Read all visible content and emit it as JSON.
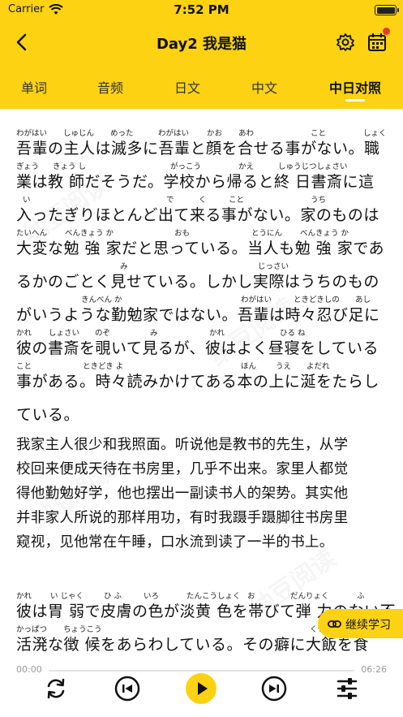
{
  "status_bar": {
    "carrier": "Carrier",
    "time": "7:52 PM"
  },
  "nav": {
    "title": "Day2 我是猫"
  },
  "tabs": [
    {
      "label": "单词"
    },
    {
      "label": "音频"
    },
    {
      "label": "日文"
    },
    {
      "label": "中文"
    },
    {
      "label": "中日对照",
      "active": true
    }
  ],
  "lines": [
    {
      "ruby": [
        [
          "わがはい",
          20
        ],
        [
          "しゅじん",
          78
        ],
        [
          "めった",
          136
        ],
        [
          "わがはい",
          195
        ],
        [
          "かお",
          255
        ],
        [
          "あわ",
          294
        ],
        [
          "こと",
          383
        ],
        [
          "しょく",
          448
        ]
      ],
      "text": "吾輩の主人は滅多に吾輩と顔を合せる事がない。職"
    },
    {
      "ruby": [
        [
          "ぎょう",
          20
        ],
        [
          "きょう し",
          65
        ],
        [
          "がっこう",
          210
        ],
        [
          "かえ",
          294
        ],
        [
          "しゅうじつしょさい",
          343
        ]
      ],
      "text": "業は教 師だそうだ。学校から帰ると終 日書斎に這"
    },
    {
      "ruby": [
        [
          "い",
          28
        ],
        [
          "で",
          205
        ],
        [
          "く",
          245
        ],
        [
          "こと",
          282
        ],
        [
          "うち",
          383
        ]
      ],
      "text": "入ったぎりほとんど出て来る事がない。家のものは"
    },
    {
      "ruby": [
        [
          "たいへん",
          20
        ],
        [
          "べんきょう か",
          80
        ],
        [
          "おも",
          215
        ],
        [
          "とうにん",
          310
        ],
        [
          "べんきょう か",
          370
        ]
      ],
      "text": "大変な勉 強 家だと思っている。当人も勉 強 家であ"
    },
    {
      "ruby": [
        [
          "み",
          148
        ],
        [
          "じっさい",
          318
        ]
      ],
      "text": "るかのごとく見せている。しかし実際はうちのもの"
    },
    {
      "ruby": [
        [
          "きんべん か",
          100
        ],
        [
          "わがはい",
          297
        ],
        [
          "ときどきしの",
          362
        ],
        [
          "あし",
          438
        ]
      ],
      "text": "がいうような勤勉家ではない。吾輩は時々忍び足に"
    },
    {
      "ruby": [
        [
          "かれ",
          20
        ],
        [
          "しょさい",
          60
        ],
        [
          "のぞ",
          117
        ],
        [
          "み",
          185
        ],
        [
          "かれ",
          258
        ],
        [
          "ひる ね",
          345
        ]
      ],
      "text": "彼の書斎を覗いて見るが、彼はよく昼寝をしている"
    },
    {
      "ruby": [
        [
          "こと",
          20
        ],
        [
          "ときどき よ",
          102
        ],
        [
          "ほん",
          297
        ],
        [
          "うえ",
          340
        ],
        [
          "よだれ",
          378
        ]
      ],
      "text": "事がある。時々読みかけてある本の上に涎をたらし"
    },
    {
      "ruby": [],
      "text": "ている。"
    }
  ],
  "zh_lines": [
    "我家主人很少和我照面。听说他是教书的先生，从学",
    "校回来便成天待在书房里，几乎不出来。家里人都觉",
    "得他勤勉好学，他也摆出一副读书人的架势。其实他",
    "并非家人所说的那样用功，有时我蹑手蹑脚往书房里",
    "窥视，见他常在午睡，口水流到读了一半的书上。"
  ],
  "lines2": [
    {
      "ruby": [
        [
          "かれ",
          20
        ],
        [
          "い じゃく",
          62
        ],
        [
          "ひ ふ",
          128
        ],
        [
          "いろ",
          177
        ],
        [
          "たんこうしょく",
          230
        ],
        [
          "お",
          305
        ],
        [
          "だんりょく",
          358
        ],
        [
          "ふ",
          440
        ]
      ],
      "text": "彼は胃 弱で皮膚の色が淡黄 色を帯びて弾 力のない不"
    },
    {
      "ruby": [
        [
          "かっぱつ",
          20
        ],
        [
          "ちょうこう",
          78
        ],
        [
          "くせ",
          382
        ]
      ],
      "text": "活溌な徴 候をあらわしている。その癖に大飯を食"
    }
  ],
  "continue_button": {
    "label": "继续学习"
  },
  "player": {
    "current_time": "00:00",
    "total_time": "06:26",
    "progress": 0
  },
  "colors": {
    "accent": "#FCD212",
    "badge": "#E43B32"
  }
}
